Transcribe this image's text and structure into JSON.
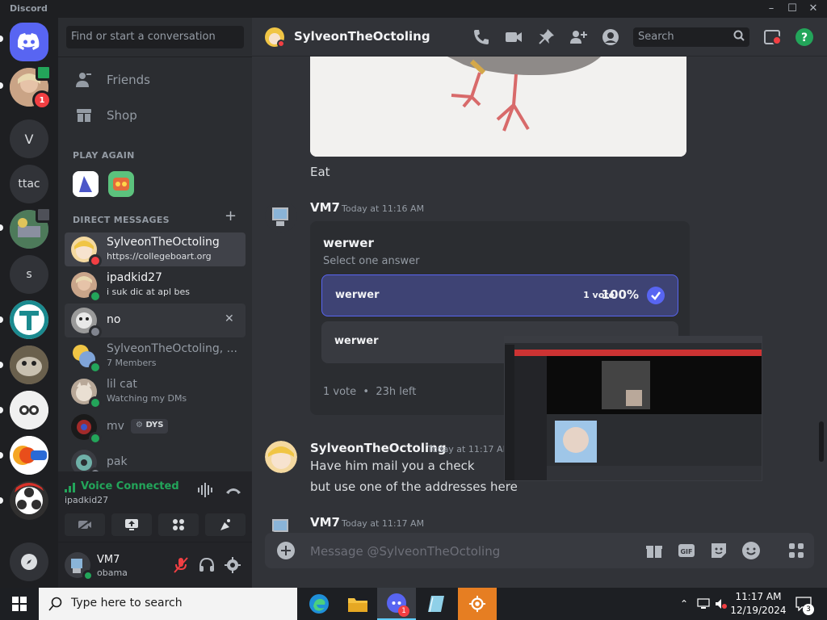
{
  "window": {
    "title": "Discord"
  },
  "servers": [
    {
      "label": "V"
    },
    {
      "label": "ttac"
    },
    {
      "label": "s"
    }
  ],
  "server_badges": {
    "user_mention_count": "1"
  },
  "sidebar": {
    "search_placeholder": "Find or start a conversation",
    "nav": {
      "friends": "Friends",
      "shop": "Shop"
    },
    "play_again_header": "PLAY AGAIN",
    "dm_header": "DIRECT MESSAGES",
    "dms": [
      {
        "name": "SylveonTheOctoling",
        "sub": "https://collegeboart.org"
      },
      {
        "name": "ipadkid27",
        "sub": "i suk dic at apl bes"
      },
      {
        "name": "no",
        "sub": ""
      },
      {
        "name": "SylveonTheOctoling, ...",
        "sub": "7 Members"
      },
      {
        "name": "lil cat",
        "sub": "Watching my DMs"
      },
      {
        "name": "mv",
        "tag": "DYS"
      },
      {
        "name": "pak"
      }
    ]
  },
  "voice": {
    "status": "Voice Connected",
    "channel": "ipadkid27"
  },
  "user": {
    "name": "VM7",
    "status": "obama"
  },
  "channel": {
    "title": "SylveonTheOctoling"
  },
  "topbar": {
    "search_placeholder": "Search"
  },
  "messages": {
    "eat": "Eat",
    "msg1": {
      "author": "VM7",
      "time": "Today at 11:16 AM"
    },
    "poll": {
      "question": "werwer",
      "hint": "Select one answer",
      "options": [
        {
          "label": "werwer",
          "votes": "1 vote",
          "percent": "100%"
        },
        {
          "label": "werwer"
        }
      ],
      "footer_votes": "1 vote",
      "footer_sep": "•",
      "footer_time": "23h left"
    },
    "msg2": {
      "author": "SylveonTheOctoling",
      "time": "Today at 11:17 AM",
      "lines": [
        "Have him mail you a check",
        "but use one of the addresses here"
      ]
    },
    "msg3": {
      "author": "VM7",
      "time": "Today at 11:17 AM"
    }
  },
  "composer": {
    "placeholder": "Message @SylveonTheOctoling"
  },
  "taskbar": {
    "search_placeholder": "Type here to search",
    "time": "11:17 AM",
    "date": "12/19/2024",
    "notif_count": "3",
    "discord_badge": "1"
  },
  "colors": {
    "accent": "#5865f2",
    "online": "#23a55a",
    "dnd": "#f23f43",
    "idle": "#80848e"
  }
}
